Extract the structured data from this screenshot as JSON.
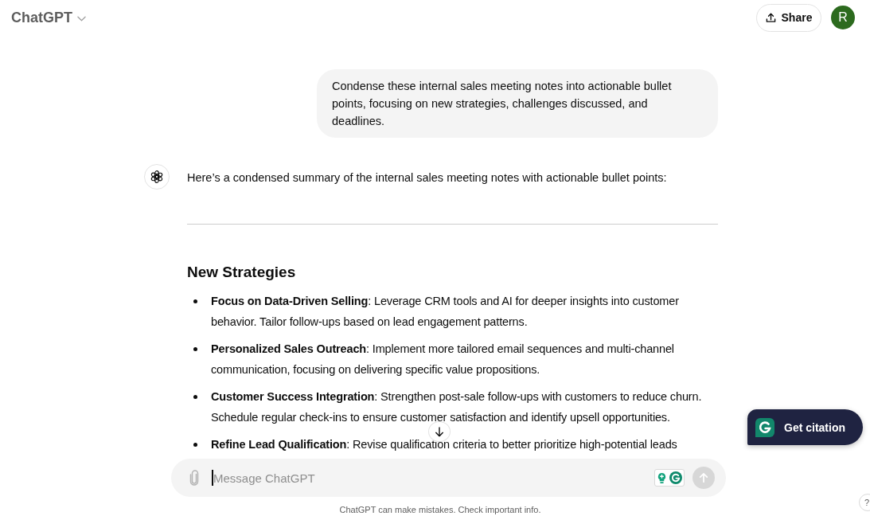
{
  "header": {
    "model_name": "ChatGPT",
    "share_label": "Share",
    "avatar_initial": "R"
  },
  "messages": [
    {
      "kind": "user",
      "text": "Condense these internal sales meeting notes into actionable bullet points, focusing on new strategies, challenges discussed, and deadlines."
    },
    {
      "kind": "assistant",
      "intro": "Here’s a condensed summary of the internal sales meeting notes with actionable bullet points:",
      "sections": [
        {
          "heading": "New Strategies",
          "bullets": [
            "**Focus on Data-Driven Selling**: Leverage CRM tools and AI for deeper insights into customer behavior. Tailor follow-ups based on lead engagement patterns.",
            "**Personalized Sales Outreach**: Implement more tailored email sequences and multi-channel communication, focusing on delivering specific value propositions.",
            "**Customer Success Integration**: Strengthen post-sale follow-ups with customers to reduce churn. Schedule regular check-ins to ensure customer satisfaction and identify upsell opportunities.",
            "**Refine Lead Qualification**: Revise qualification criteria to better prioritize high-potential leads"
          ]
        }
      ]
    }
  ],
  "composer": {
    "placeholder": "Message ChatGPT",
    "send_button": {
      "disabled": true
    }
  },
  "disclaimer": "ChatGPT can make mistakes. Check important info.",
  "citation_button": {
    "label": "Get citation"
  },
  "help_button": {
    "label": "?"
  }
}
